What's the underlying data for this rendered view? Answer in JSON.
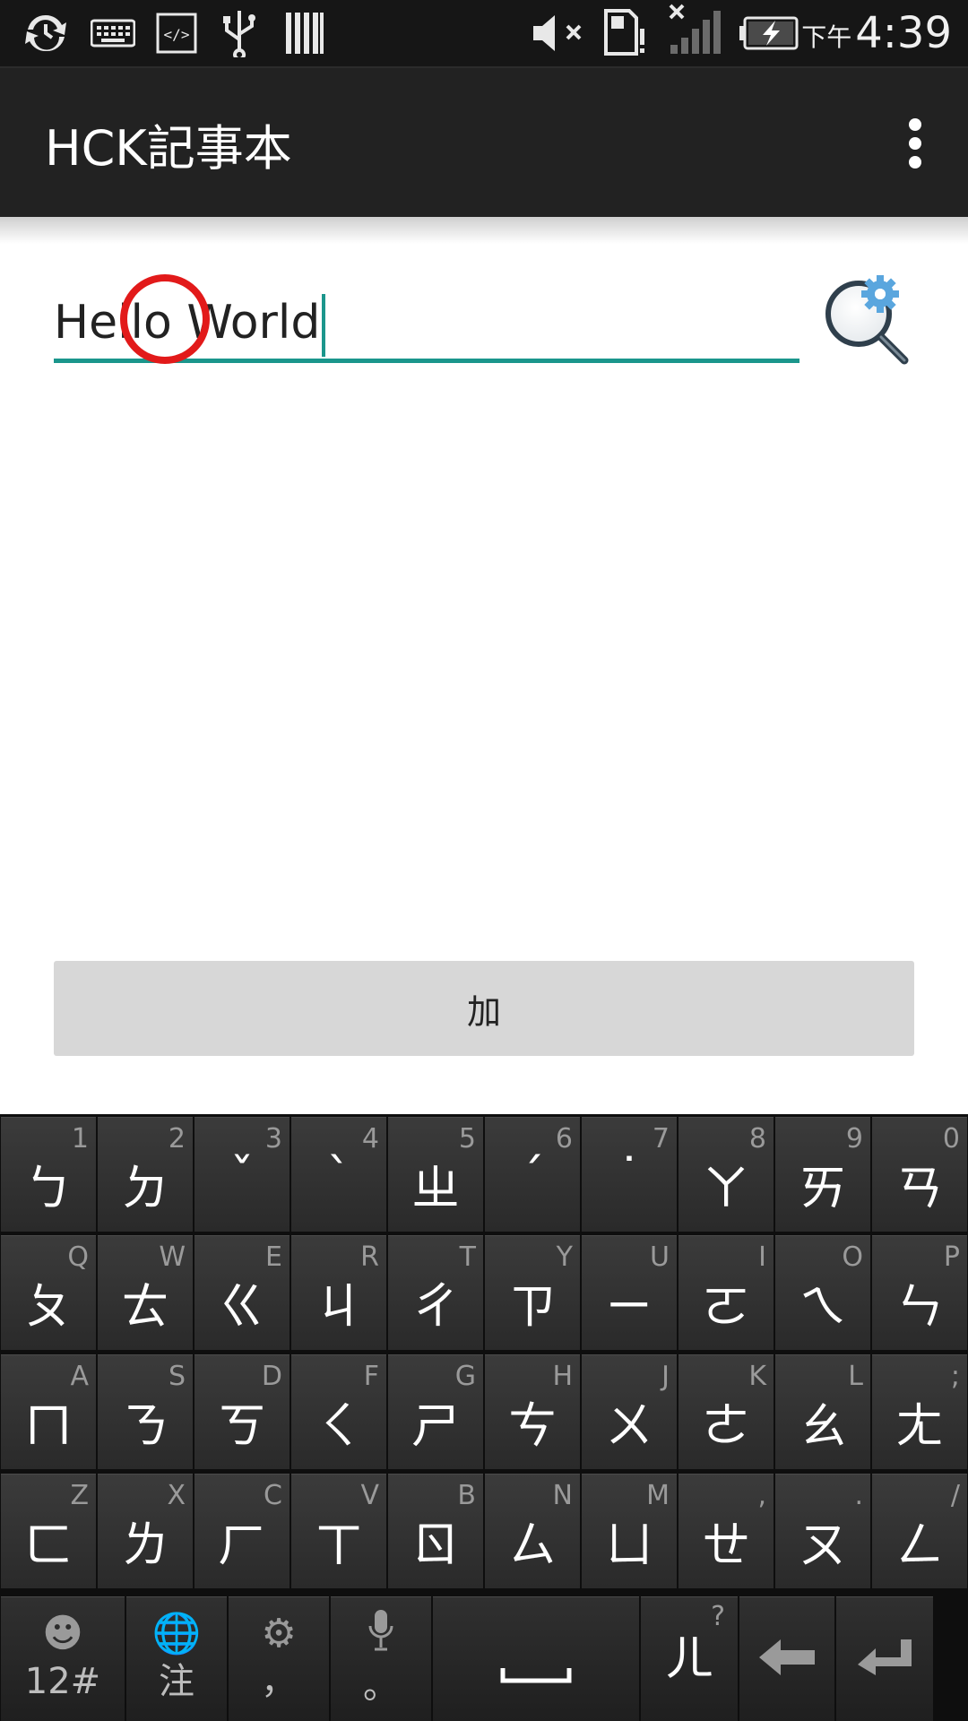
{
  "status_bar": {
    "time_period": "下午",
    "time": "4:39",
    "icons": [
      "sync-icon",
      "keyboard-icon",
      "code-icon",
      "usb-icon",
      "barcode-icon",
      "mute-icon",
      "sd-card-icon",
      "no-signal-icon",
      "battery-charging-icon"
    ]
  },
  "action_bar": {
    "title": "HCK記事本",
    "overflow_icon": "overflow-menu-icon"
  },
  "editor": {
    "text": "Hello World",
    "search_icon": "search-settings-icon"
  },
  "add_button_label": "加",
  "keyboard": {
    "row1": [
      {
        "hint": "1",
        "main": "ㄅ"
      },
      {
        "hint": "2",
        "main": "ㄉ"
      },
      {
        "hint": "3",
        "main": "ˇ"
      },
      {
        "hint": "4",
        "main": "ˋ"
      },
      {
        "hint": "5",
        "main": "ㄓ"
      },
      {
        "hint": "6",
        "main": "ˊ"
      },
      {
        "hint": "7",
        "main": "˙"
      },
      {
        "hint": "8",
        "main": "ㄚ"
      },
      {
        "hint": "9",
        "main": "ㄞ"
      },
      {
        "hint": "0",
        "main": "ㄢ"
      }
    ],
    "row2": [
      {
        "hint": "Q",
        "main": "ㄆ"
      },
      {
        "hint": "W",
        "main": "ㄊ"
      },
      {
        "hint": "E",
        "main": "ㄍ"
      },
      {
        "hint": "R",
        "main": "ㄐ"
      },
      {
        "hint": "T",
        "main": "ㄔ"
      },
      {
        "hint": "Y",
        "main": "ㄗ"
      },
      {
        "hint": "U",
        "main": "ㄧ"
      },
      {
        "hint": "I",
        "main": "ㄛ"
      },
      {
        "hint": "O",
        "main": "ㄟ"
      },
      {
        "hint": "P",
        "main": "ㄣ"
      }
    ],
    "row3": [
      {
        "hint": "A",
        "main": "ㄇ"
      },
      {
        "hint": "S",
        "main": "ㄋ"
      },
      {
        "hint": "D",
        "main": "ㄎ"
      },
      {
        "hint": "F",
        "main": "ㄑ"
      },
      {
        "hint": "G",
        "main": "ㄕ"
      },
      {
        "hint": "H",
        "main": "ㄘ"
      },
      {
        "hint": "J",
        "main": "ㄨ"
      },
      {
        "hint": "K",
        "main": "ㄜ"
      },
      {
        "hint": "L",
        "main": "ㄠ"
      },
      {
        "hint": ";",
        "main": "ㄤ"
      }
    ],
    "row4": [
      {
        "hint": "Z",
        "main": "ㄈ"
      },
      {
        "hint": "X",
        "main": "ㄌ"
      },
      {
        "hint": "C",
        "main": "ㄏ"
      },
      {
        "hint": "V",
        "main": "ㄒ"
      },
      {
        "hint": "B",
        "main": "ㄖ"
      },
      {
        "hint": "N",
        "main": "ㄙ"
      },
      {
        "hint": "M",
        "main": "ㄩ"
      },
      {
        "hint": ",",
        "main": "ㄝ"
      },
      {
        "hint": ".",
        "main": "ㄡ"
      },
      {
        "hint": "/",
        "main": "ㄥ"
      }
    ],
    "bottom": {
      "numbers_label": "12#",
      "lang_label": "注",
      "comma_label": "，",
      "period_label": "。",
      "er_label": "ㄦ",
      "er_hint": "?",
      "icons": [
        "emoji-icon",
        "globe-icon",
        "settings-icon",
        "microphone-icon",
        "space-icon",
        "backspace-icon",
        "enter-icon"
      ]
    }
  }
}
